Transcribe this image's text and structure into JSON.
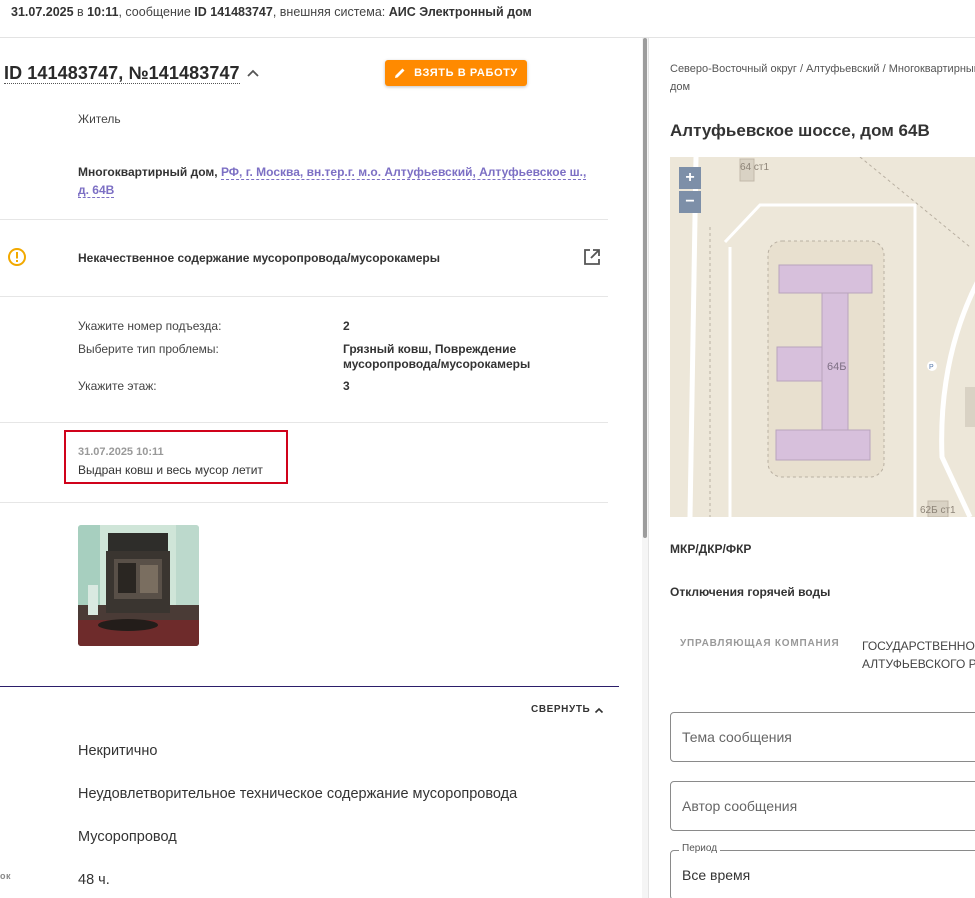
{
  "topbar": {
    "datetime": "31.07.2025",
    "at": "в",
    "time": "10:11",
    "msg_label": ", сообщение",
    "msg_id": "ID 141483747",
    "ext_label": ", внешняя система:",
    "ext_system": "АИС Электронный дом"
  },
  "ticket": {
    "title": "ID 141483747, №141483747",
    "take_button": "ВЗЯТЬ В РАБОТУ",
    "author_role": "Житель",
    "building_type": "Многоквартирный дом,",
    "address_link": "РФ, г. Москва, вн.тер.г. м.о. Алтуфьевский, Алтуфьевское ш., д. 64В",
    "category": "Некачественное содержание мусоропровода/мусорокамеры",
    "details": [
      {
        "label": "Укажите номер подъезда:",
        "value": "2"
      },
      {
        "label": "Выберите тип проблемы:",
        "value": "Грязный ковш, Повреждение мусоропровода/мусорокамеры"
      },
      {
        "label": "Укажите этаж:",
        "value": "3"
      }
    ],
    "comment": {
      "date": "31.07.2025 10:11",
      "text": "Выдран ковш и весь мусор летит"
    },
    "collapse_label": "СВЕРНУТЬ",
    "criticality": "Некритично",
    "problem_desc": "Неудовлетворительное техническое содержание мусоропровода",
    "object": "Мусоропровод",
    "deadline_label_cut": "ок",
    "deadline": "48 ч."
  },
  "building": {
    "breadcrumb": "Северо-Восточный округ / Алтуфьевский / Многоквартирный дом",
    "address": "Алтуфьевское шоссе, дом 64В",
    "map": {
      "zoom_in": "+",
      "zoom_out": "−",
      "labels": [
        "64 ст1",
        "64Б",
        "62Б ст1",
        "P"
      ]
    },
    "mkr_header": "МКР/ДКР/ФКР",
    "hot_water_header": "Отключения горячей воды",
    "mc_label": "УПРАВЛЯЮЩАЯ КОМПАНИЯ",
    "mc_value_line1": "ГОСУДАРСТВЕННОЕ БЮДЖЕТНОЕ",
    "mc_value_line2": "АЛТУФЬЕВСКОГО РАЙОНА"
  },
  "form": {
    "topic_placeholder": "Тема сообщения",
    "author_placeholder": "Автор сообщения",
    "period_legend": "Период",
    "period_value": "Все время"
  },
  "colors": {
    "accent_orange": "#ff8a00",
    "link_purple": "#7c6fc4",
    "highlight_red": "#d0021b",
    "warning_yellow": "#f2a900"
  }
}
